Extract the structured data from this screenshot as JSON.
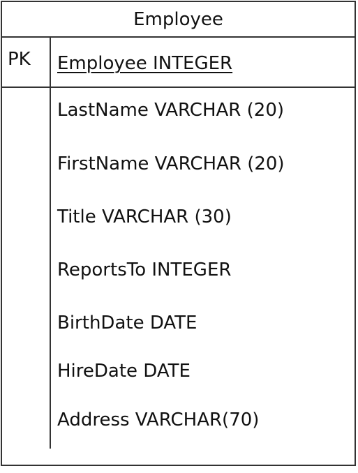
{
  "entity": {
    "name": "Employee",
    "primary_key": {
      "label": "PK",
      "field": "Employee INTEGER"
    },
    "attributes": [
      "LastName VARCHAR (20)",
      "FirstName VARCHAR (20)",
      "Title VARCHAR (30)",
      "ReportsTo INTEGER",
      "BirthDate DATE",
      "HireDate DATE",
      "Address VARCHAR(70)"
    ]
  }
}
